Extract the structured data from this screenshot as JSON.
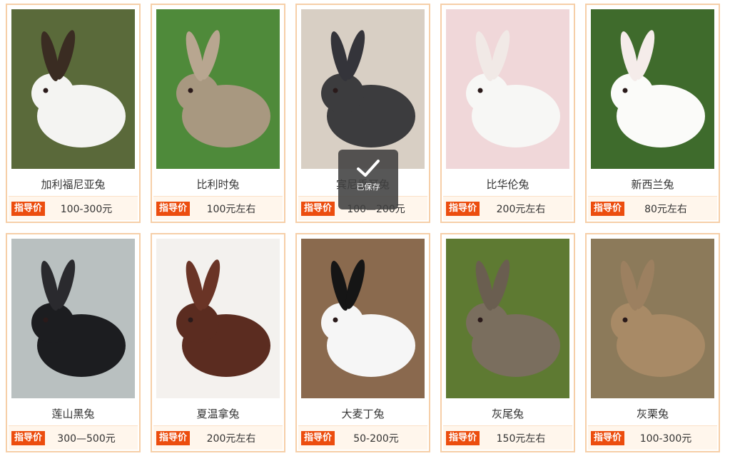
{
  "tag_label": "指导价",
  "toast": {
    "icon": "checkmark-icon",
    "text": "已保存"
  },
  "rabbits": [
    {
      "name": "加利福尼亚兔",
      "price": "100-300元",
      "bg": "#5a6a3a",
      "body": "#f4f4f2",
      "ear": "#3a2c22"
    },
    {
      "name": "比利时兔",
      "price": "100元左右",
      "bg": "#4f8a3a",
      "body": "#a89880",
      "ear": "#b8a690"
    },
    {
      "name": "宾尼垂耳兔",
      "price": "100—200元",
      "bg": "#d8cfc4",
      "body": "#3c3c3e",
      "ear": "#34343a"
    },
    {
      "name": "比华伦兔",
      "price": "200元左右",
      "bg": "#f0d7d9",
      "body": "#f7f7f5",
      "ear": "#f1e9e6"
    },
    {
      "name": "新西兰兔",
      "price": "80元左右",
      "bg": "#3f6b2c",
      "body": "#fbfbf9",
      "ear": "#f5ecea"
    },
    {
      "name": "莲山黑兔",
      "price": "300—500元",
      "bg": "#b9c0c0",
      "body": "#1c1d20",
      "ear": "#2a2a2e"
    },
    {
      "name": "夏温拿兔",
      "price": "200元左右",
      "bg": "#f3f1ee",
      "body": "#5b2c20",
      "ear": "#6a3426"
    },
    {
      "name": "大麦丁兔",
      "price": "50-200元",
      "bg": "#8a6a4e",
      "body": "#f6f6f6",
      "ear": "#151515"
    },
    {
      "name": "灰尾兔",
      "price": "150元左右",
      "bg": "#5e7a32",
      "body": "#7a6e5e",
      "ear": "#6a5e50"
    },
    {
      "name": "灰栗兔",
      "price": "100-300元",
      "bg": "#8c7a5a",
      "body": "#a88a66",
      "ear": "#9c8060"
    }
  ]
}
